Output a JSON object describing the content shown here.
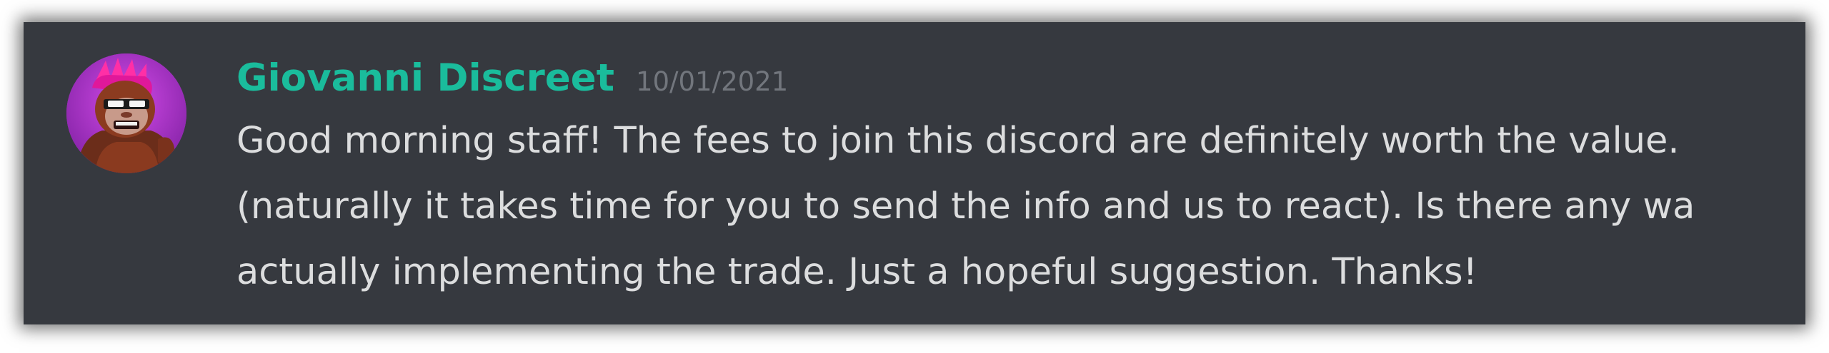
{
  "message": {
    "author": "Giovanni Discreet",
    "timestamp": "10/01/2021",
    "lines": [
      "Good morning staff! The fees to join this discord are definitely worth the value.",
      "(naturally it takes time for you to send the info and us to react). Is there any wa",
      "actually implementing the trade. Just a hopeful suggestion. Thanks!"
    ]
  },
  "colors": {
    "background": "#36393f",
    "author": "#1abc9c",
    "timestamp": "#72767d",
    "text": "#dcddde"
  },
  "avatar": {
    "icon": "gorilla-avatar-icon"
  }
}
